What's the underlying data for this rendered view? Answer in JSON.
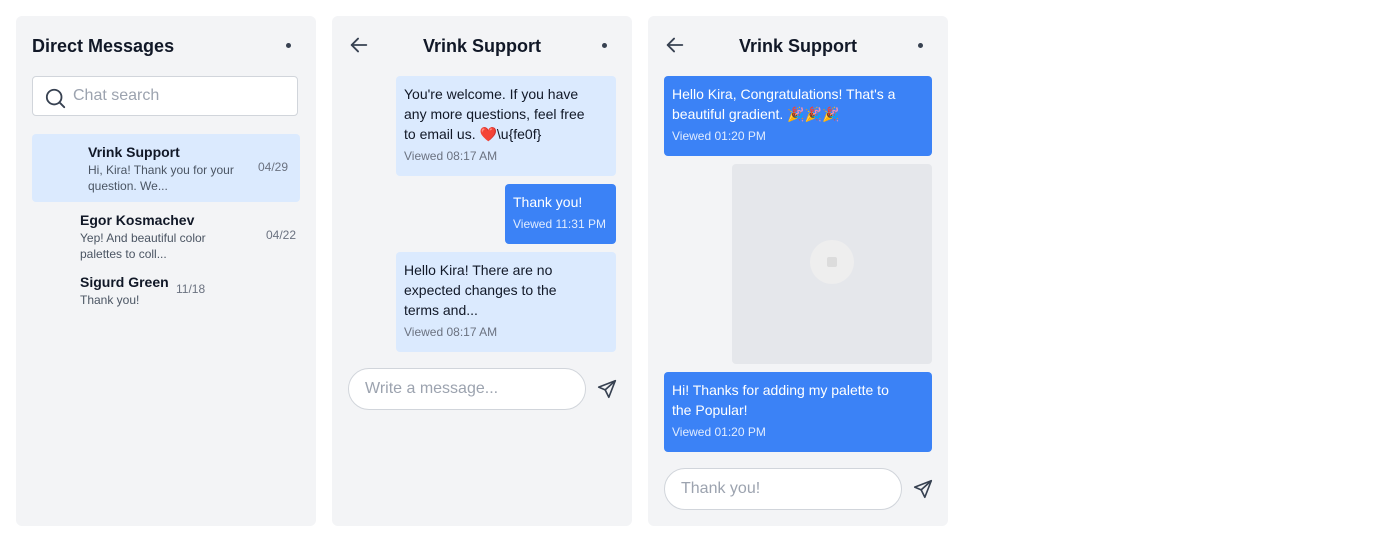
{
  "dm_list": {
    "title": "Direct Messages",
    "search_placeholder": "Chat search",
    "conversations": [
      {
        "name": "Vrink Support",
        "preview_line1": "Hi, Kira! Thank you for your",
        "preview_line2": "question. We...",
        "date": "04/29",
        "active": true
      },
      {
        "name": "Egor Kosmachev",
        "preview_line1": "Yep! And beautiful color",
        "preview_line2": "palettes to coll...",
        "date": "04/22",
        "active": false
      },
      {
        "name": "Sigurd Green",
        "preview_line1": "Thank you!",
        "preview_line2": "",
        "date": "11/18",
        "active": false
      }
    ]
  },
  "chat_mid": {
    "title": "Vrink Support",
    "messages": [
      {
        "direction": "in",
        "line1": "You're welcome. If you have",
        "line2": "any more questions, feel free",
        "line3": "to email us. ❤️\\u{fe0f}",
        "status": "Viewed 08:17 AM"
      },
      {
        "direction": "out",
        "line1": "Thank you!",
        "status": "Viewed 11:31 PM"
      },
      {
        "direction": "in",
        "line1": "Hello Kira! There are no",
        "line2": "expected changes to the",
        "line3": "terms and...",
        "status": "Viewed 08:17 AM"
      }
    ],
    "input_placeholder": "Write a message...",
    "input_value": ""
  },
  "chat_right": {
    "title": "Vrink Support",
    "messages": [
      {
        "direction": "out",
        "line1": "Hello Kira, Congratulations! That's a",
        "line2": "beautiful gradient. 🎉🎉🎉",
        "status": "Viewed 01:20 PM"
      },
      {
        "direction": "out",
        "type": "image"
      },
      {
        "direction": "out",
        "line1": "Hi! Thanks for adding my palette to",
        "line2": "the Popular!",
        "status": "Viewed 01:20 PM"
      }
    ],
    "input_placeholder": "Thank you!",
    "input_value": ""
  },
  "icons": {
    "search": "search-icon",
    "menu": "more-dot-icon",
    "back": "arrow-left-icon",
    "send": "paper-plane-icon"
  },
  "colors": {
    "accent": "#3b82f6",
    "incoming_bubble": "#dbeafe",
    "panel_bg": "#f3f4f6"
  }
}
